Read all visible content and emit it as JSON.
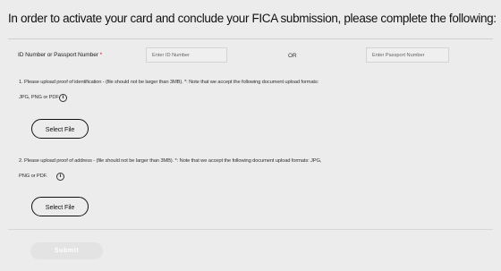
{
  "form": {
    "title": "In order to activate your card and conclude your FICA submission, please complete the following:",
    "id_field": {
      "label": "ID Number or Passport Number",
      "required_mark": "*",
      "id_placeholder": "Enter ID Number",
      "or_text": "OR",
      "passport_placeholder": "Enter Passport Number"
    },
    "identification": {
      "instruction_line1": "1. Please upload proof of identification - (file should not be larger than 3MB). *: Note that we accept the following document upload formats:",
      "instruction_line2": "JPG, PNG or PDF",
      "info_icon": "info-icon",
      "button_label": "Select File"
    },
    "address": {
      "instruction_line1": "2. Please upload proof of address - (file should not be larger than 3MB). *: Note that we accept the following document upload formats: JPG,",
      "instruction_line2": "PNG or PDF.",
      "info_icon": "info-icon",
      "button_label": "Select File"
    },
    "submit_label": "Submit",
    "colors": {
      "background": "#ececec",
      "required": "#d0021b",
      "submit_disabled_bg": "#e3e3e3"
    }
  }
}
